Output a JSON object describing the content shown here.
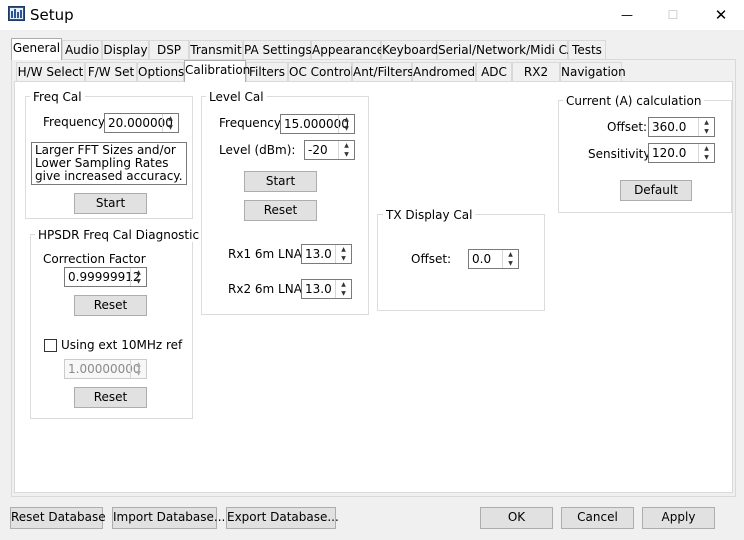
{
  "window": {
    "title": "Setup",
    "minimize_glyph": "—",
    "maximize_glyph": "☐",
    "close_glyph": "✕"
  },
  "top_tabs": [
    "General",
    "Audio",
    "Display",
    "DSP",
    "Transmit",
    "PA Settings",
    "Appearance",
    "Keyboard",
    "Serial/Network/Midi CAT",
    "Tests"
  ],
  "sub_tabs": [
    "H/W Select",
    "F/W Set",
    "Options",
    "Calibration",
    "Filters",
    "OC Control",
    "Ant/Filters",
    "Andromeda",
    "ADC",
    "RX2",
    "Navigation"
  ],
  "freq_cal": {
    "title": "Freq Cal",
    "frequency_label": "Frequency:",
    "frequency_value": "20.000000",
    "note": "Larger FFT Sizes and/or Lower Sampling Rates give increased accuracy.",
    "start_label": "Start"
  },
  "hpsdr_diag": {
    "title": "HPSDR Freq Cal Diagnostic",
    "correction_label": "Correction Factor",
    "correction_value": "0.99999912",
    "reset_label": "Reset",
    "ext_ref_label": "Using ext 10MHz ref",
    "ext_ref_value": "1.00000000",
    "reset2_label": "Reset"
  },
  "level_cal": {
    "title": "Level Cal",
    "frequency_label": "Frequency:",
    "frequency_value": "15.000000",
    "level_label": "Level (dBm):",
    "level_value": "-20",
    "start_label": "Start",
    "reset_label": "Reset",
    "rx1_label": "Rx1 6m LNA:",
    "rx1_value": "13.0",
    "rx2_label": "Rx2 6m LNA:",
    "rx2_value": "13.0"
  },
  "tx_display_cal": {
    "title": "TX Display Cal",
    "offset_label": "Offset:",
    "offset_value": "0.0"
  },
  "current_calc": {
    "title": "Current (A) calculation",
    "offset_label": "Offset:",
    "offset_value": "360.0",
    "sensitivity_label": "Sensitivity:",
    "sensitivity_value": "120.0",
    "default_label": "Default"
  },
  "footer": {
    "reset_db": "Reset Database",
    "import_db": "Import Database...",
    "export_db": "Export Database...",
    "ok": "OK",
    "cancel": "Cancel",
    "apply": "Apply"
  }
}
